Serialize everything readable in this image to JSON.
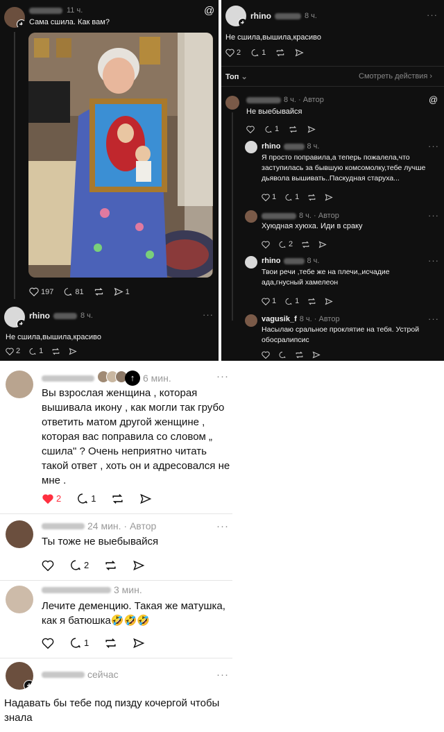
{
  "left_panel": {
    "post": {
      "time": "11 ч.",
      "text": "Сама сшила. Как вам?",
      "likes": "197",
      "comments": "81",
      "shares": "1"
    },
    "reply": {
      "username": "rhino",
      "time": "8 ч.",
      "text": "Не сшила,вышила,красиво",
      "likes": "2",
      "comments": "1"
    }
  },
  "right_panel": {
    "post": {
      "username": "rhino",
      "time": "8 ч.",
      "text": "Не сшила,вышила,красиво",
      "likes": "2",
      "comments": "1"
    },
    "sort_label": "Топ",
    "view_activity": "Смотреть действия",
    "comments": [
      {
        "time": "8 ч. · Автор",
        "text": "Не выебывайся",
        "comments": "1"
      },
      {
        "username": "rhino",
        "time": "8 ч.",
        "text": "Я просто поправила,а теперь пожалела,что заступилась за бывшую комсомолку,тебе лучше дьявола вышивать..Паскудная старуха...",
        "likes": "1",
        "comments": "1"
      },
      {
        "time": "8 ч. · Автор",
        "text": "Хуюдная хуюха. Иди в сраку",
        "comments": "2"
      },
      {
        "username": "rhino",
        "time": "8 ч.",
        "text": "Твои речи ,тебе же на плечи,,исчадие ада,гнусный хамелеон",
        "likes": "1",
        "comments": "1"
      },
      {
        "username": "vagusik_f",
        "time": "8 ч. · Автор",
        "text": "Насылаю сральное проклятие на тебя. Устрой обосралипсис"
      }
    ]
  },
  "bottom": {
    "comments": [
      {
        "time": "6 мин.",
        "text": "Вы взрослая женщина , которая вышивала икону , как могли так грубо ответить матом другой женщине , которая вас поправила со словом „ сшила\" ? Очень неприятно читать такой ответ , хоть он и адресовался не мне .",
        "likes": "2",
        "comments": "1"
      },
      {
        "time": "24 мин. · Автор",
        "text": "Ты тоже не выебывайся",
        "comments": "2"
      },
      {
        "time": "3 мин.",
        "text": "Лечите деменцию. Такая же матушка, как я батюшка🤣🤣🤣",
        "comments": "1"
      },
      {
        "time": "сейчас",
        "text": "Надавать бы тебе под пизду кочергой чтобы знала"
      }
    ]
  },
  "colors": {
    "dark_bg": "#101010",
    "like_red": "#ff3040"
  }
}
